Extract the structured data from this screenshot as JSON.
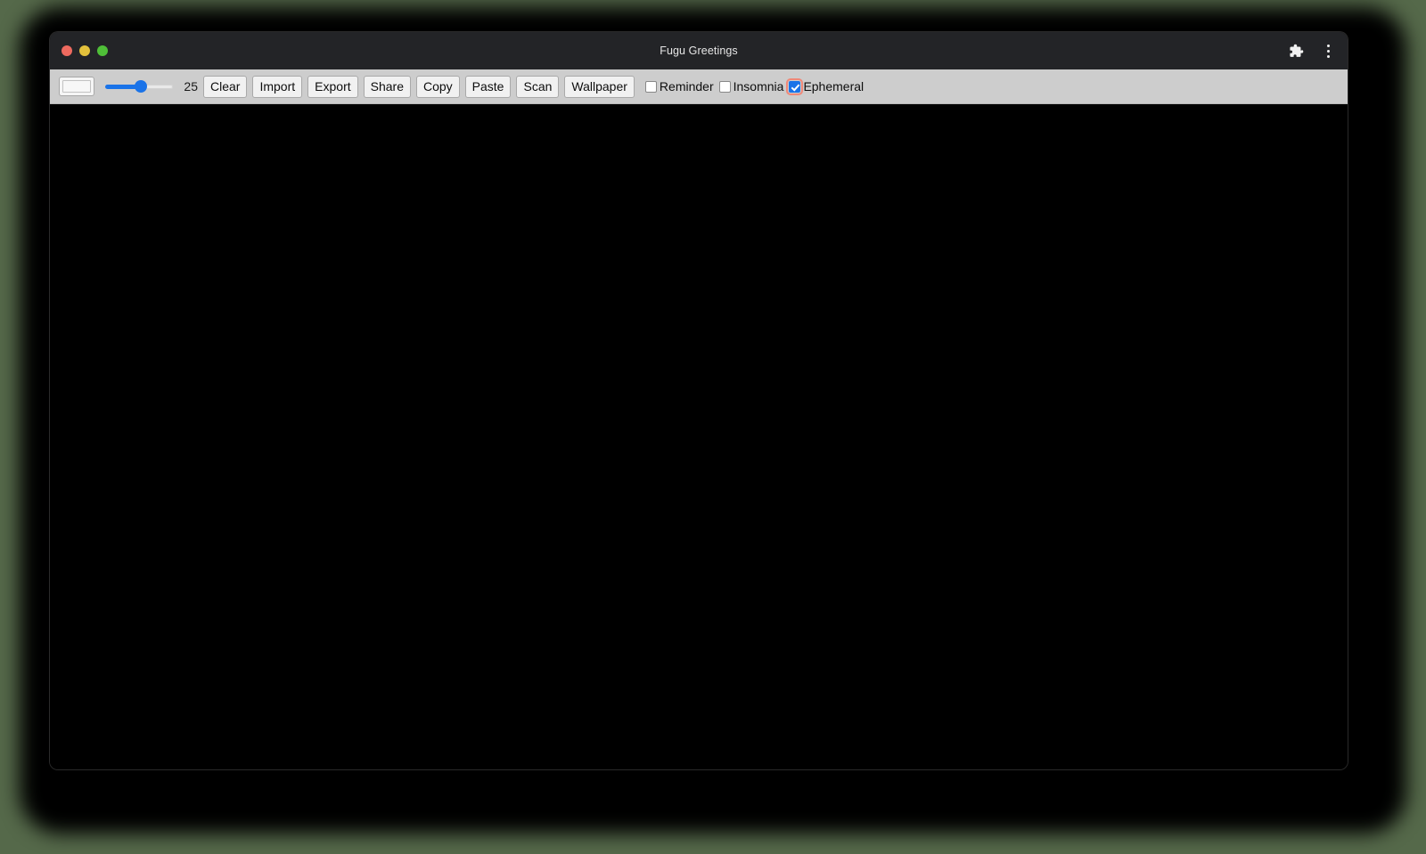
{
  "window": {
    "title": "Fugu Greetings",
    "traffic_lights": [
      {
        "name": "close",
        "color": "#ee6a5f"
      },
      {
        "name": "minimize",
        "color": "#e3c13c"
      },
      {
        "name": "maximize",
        "color": "#4fbf38"
      }
    ],
    "actions": [
      {
        "name": "extensions-icon",
        "glyph": "puzzle"
      },
      {
        "name": "browser-menu-icon",
        "glyph": "three-dots-vertical"
      }
    ]
  },
  "toolbar": {
    "color_picker": {
      "label": "color-picker",
      "value": "#f7f7f7"
    },
    "slider": {
      "label": "line-width-slider",
      "value": 25,
      "min": 0,
      "max": 50,
      "percent": 52
    },
    "slider_value_text": "25",
    "buttons": [
      {
        "label": "Clear",
        "name": "clear-button"
      },
      {
        "label": "Import",
        "name": "import-button"
      },
      {
        "label": "Export",
        "name": "export-button"
      },
      {
        "label": "Share",
        "name": "share-button"
      },
      {
        "label": "Copy",
        "name": "copy-button"
      },
      {
        "label": "Paste",
        "name": "paste-button"
      },
      {
        "label": "Scan",
        "name": "scan-button"
      },
      {
        "label": "Wallpaper",
        "name": "wallpaper-button"
      }
    ],
    "checkboxes": [
      {
        "label": "Reminder",
        "name": "reminder-checkbox",
        "checked": false,
        "focused": false
      },
      {
        "label": "Insomnia",
        "name": "insomnia-checkbox",
        "checked": false,
        "focused": false
      },
      {
        "label": "Ephemeral",
        "name": "ephemeral-checkbox",
        "checked": true,
        "focused": true
      }
    ]
  },
  "canvas": {
    "name": "drawing-canvas",
    "background": "#000000"
  },
  "colors": {
    "accent": "#1a73e8",
    "toolbar_bg": "#cdcdcd",
    "titlebar_bg": "#232427",
    "desktop_bg": "#55694a",
    "focus_ring": "#f08878"
  }
}
